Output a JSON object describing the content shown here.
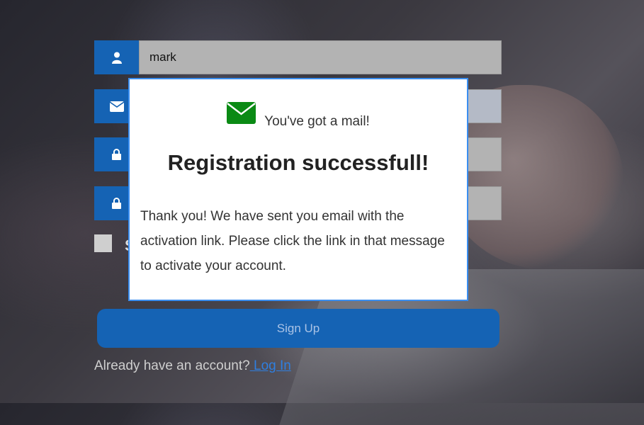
{
  "form": {
    "username_value": "mark",
    "remember_label_fragment": "S",
    "signup_label": "Sign Up",
    "login_prompt": "Already have an account?",
    "login_link": " Log In"
  },
  "modal": {
    "mail_text": "You've got a mail!",
    "title": "Registration successfull!",
    "message": "Thank you! We have sent you email with the activation link. Please click the link in that message to activate your account."
  },
  "icons": {
    "field1": "user-icon",
    "field2": "envelope-icon",
    "field3": "lock-icon",
    "field4": "lock-icon",
    "modal": "envelope-icon"
  },
  "colors": {
    "accent": "#1563b4",
    "mail_icon": "#0a8a14",
    "modal_border": "#3a8ef0"
  }
}
